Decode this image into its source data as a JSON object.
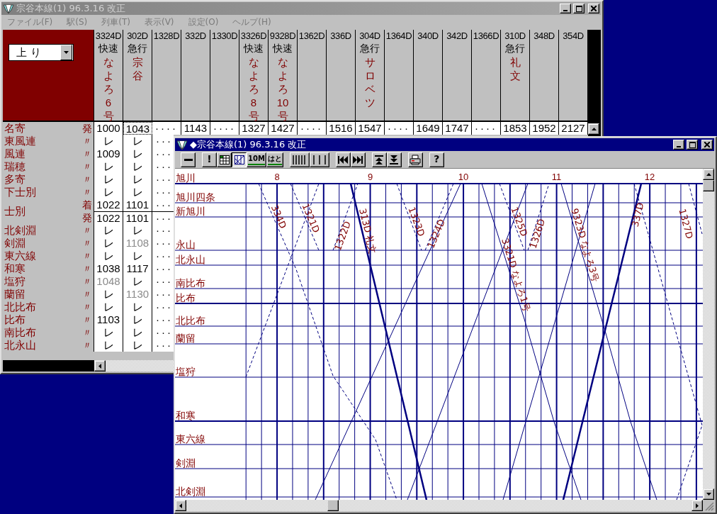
{
  "timetable_window": {
    "title": "宗谷本線(1) 96.3.16 改正",
    "active": false,
    "menu": [
      "ファイル(F)",
      "駅(S)",
      "列車(T)",
      "表示(V)",
      "設定(O)",
      "ヘルプ(H)"
    ],
    "direction": "上 り",
    "trains": [
      {
        "number": "3324D",
        "type": "快速",
        "name": "なよろ6号"
      },
      {
        "number": "302D",
        "type": "急行",
        "name": "宗谷"
      },
      {
        "number": "1328D"
      },
      {
        "number": "332D"
      },
      {
        "number": "1330D"
      },
      {
        "number": "3326D",
        "type": "快速",
        "name": "なよろ8号"
      },
      {
        "number": "9328D",
        "type": "快速",
        "name": "なよろ10号"
      },
      {
        "number": "1362D"
      },
      {
        "number": "336D"
      },
      {
        "number": "304D",
        "type": "急行",
        "name": "サロベツ"
      },
      {
        "number": "1364D"
      },
      {
        "number": "340D"
      },
      {
        "number": "342D"
      },
      {
        "number": "1366D"
      },
      {
        "number": "310D",
        "type": "急行",
        "name": "礼文"
      },
      {
        "number": "348D"
      },
      {
        "number": "354D"
      }
    ],
    "stations": [
      {
        "name": "名寄",
        "lines": [
          {
            "mark": "発",
            "cells": [
              {
                "v": "1000",
                "grey": false,
                "selected": false
              },
              {
                "v": "1043",
                "grey": false,
                "selected": true
              },
              {
                "v": "····",
                "grey": false,
                "selected": false
              },
              {
                "v": "1143",
                "grey": false,
                "selected": false
              },
              {
                "v": "····",
                "grey": false,
                "selected": false
              },
              {
                "v": "1327",
                "grey": false,
                "selected": false
              },
              {
                "v": "1427",
                "grey": false,
                "selected": false
              },
              {
                "v": "····",
                "grey": false,
                "selected": false
              },
              {
                "v": "1516",
                "grey": false,
                "selected": false
              },
              {
                "v": "1547",
                "grey": false,
                "selected": false
              },
              {
                "v": "····",
                "grey": false,
                "selected": false
              },
              {
                "v": "1649",
                "grey": false,
                "selected": false
              },
              {
                "v": "1747",
                "grey": false,
                "selected": false
              },
              {
                "v": "····",
                "grey": false,
                "selected": false
              },
              {
                "v": "1853",
                "grey": false,
                "selected": false
              },
              {
                "v": "1952",
                "grey": false,
                "selected": false
              },
              {
                "v": "2127",
                "grey": false,
                "selected": false
              }
            ]
          }
        ]
      },
      {
        "name": "東風連",
        "lines": [
          {
            "mark": "〃",
            "cells": [
              {
                "v": "レ",
                "grey": false,
                "selected": false
              },
              {
                "v": "レ",
                "grey": false,
                "selected": false
              },
              {
                "v": "···",
                "grey": false,
                "selected": false
              }
            ]
          }
        ]
      },
      {
        "name": "風連",
        "lines": [
          {
            "mark": "〃",
            "cells": [
              {
                "v": "1009",
                "grey": false,
                "selected": false
              },
              {
                "v": "レ",
                "grey": false,
                "selected": false
              },
              {
                "v": "···",
                "grey": false,
                "selected": false
              }
            ]
          }
        ]
      },
      {
        "name": "瑞穂",
        "lines": [
          {
            "mark": "〃",
            "cells": [
              {
                "v": "レ",
                "grey": false,
                "selected": false
              },
              {
                "v": "レ",
                "grey": false,
                "selected": false
              },
              {
                "v": "···",
                "grey": false,
                "selected": false
              }
            ]
          }
        ]
      },
      {
        "name": "多寄",
        "lines": [
          {
            "mark": "〃",
            "cells": [
              {
                "v": "レ",
                "grey": false,
                "selected": false
              },
              {
                "v": "レ",
                "grey": false,
                "selected": false
              },
              {
                "v": "···",
                "grey": false,
                "selected": false
              }
            ]
          }
        ]
      },
      {
        "name": "下士別",
        "lines": [
          {
            "mark": "〃",
            "cells": [
              {
                "v": "レ",
                "grey": false,
                "selected": false
              },
              {
                "v": "レ",
                "grey": false,
                "selected": false
              },
              {
                "v": "···",
                "grey": false,
                "selected": false
              }
            ]
          }
        ]
      },
      {
        "name": "士別",
        "lines": [
          {
            "mark": "着",
            "cells": [
              {
                "v": "1022",
                "grey": false,
                "selected": false
              },
              {
                "v": "1101",
                "grey": false,
                "selected": false
              },
              {
                "v": "···",
                "grey": false,
                "selected": false
              }
            ]
          },
          {
            "mark": "発",
            "cells": [
              {
                "v": "1022",
                "grey": false,
                "selected": false
              },
              {
                "v": "1101",
                "grey": false,
                "selected": false
              },
              {
                "v": "···",
                "grey": false,
                "selected": false
              }
            ]
          }
        ]
      },
      {
        "name": "北剣淵",
        "lines": [
          {
            "mark": "〃",
            "cells": [
              {
                "v": "レ",
                "grey": false,
                "selected": false
              },
              {
                "v": "レ",
                "grey": false,
                "selected": false
              },
              {
                "v": "···",
                "grey": false,
                "selected": false
              }
            ]
          }
        ]
      },
      {
        "name": "剣淵",
        "lines": [
          {
            "mark": "〃",
            "cells": [
              {
                "v": "レ",
                "grey": false,
                "selected": false
              },
              {
                "v": "1108",
                "grey": true,
                "selected": false
              },
              {
                "v": "···",
                "grey": false,
                "selected": false
              }
            ]
          }
        ]
      },
      {
        "name": "東六線",
        "lines": [
          {
            "mark": "〃",
            "cells": [
              {
                "v": "レ",
                "grey": false,
                "selected": false
              },
              {
                "v": "レ",
                "grey": false,
                "selected": false
              },
              {
                "v": "···",
                "grey": false,
                "selected": false
              }
            ]
          }
        ]
      },
      {
        "name": "和寒",
        "lines": [
          {
            "mark": "〃",
            "cells": [
              {
                "v": "1038",
                "grey": false,
                "selected": false
              },
              {
                "v": "1117",
                "grey": false,
                "selected": false
              },
              {
                "v": "···",
                "grey": false,
                "selected": false
              }
            ]
          }
        ]
      },
      {
        "name": "塩狩",
        "lines": [
          {
            "mark": "〃",
            "cells": [
              {
                "v": "1048",
                "grey": true,
                "selected": false
              },
              {
                "v": "レ",
                "grey": false,
                "selected": false
              },
              {
                "v": "···",
                "grey": false,
                "selected": false
              }
            ]
          }
        ]
      },
      {
        "name": "蘭留",
        "lines": [
          {
            "mark": "〃",
            "cells": [
              {
                "v": "レ",
                "grey": false,
                "selected": false
              },
              {
                "v": "1130",
                "grey": true,
                "selected": false
              },
              {
                "v": "···",
                "grey": false,
                "selected": false
              }
            ]
          }
        ]
      },
      {
        "name": "北比布",
        "lines": [
          {
            "mark": "〃",
            "cells": [
              {
                "v": "レ",
                "grey": false,
                "selected": false
              },
              {
                "v": "レ",
                "grey": false,
                "selected": false
              },
              {
                "v": "···",
                "grey": false,
                "selected": false
              }
            ]
          }
        ]
      },
      {
        "name": "比布",
        "lines": [
          {
            "mark": "〃",
            "cells": [
              {
                "v": "1103",
                "grey": false,
                "selected": false
              },
              {
                "v": "レ",
                "grey": false,
                "selected": false
              },
              {
                "v": "···",
                "grey": false,
                "selected": false
              }
            ]
          }
        ]
      },
      {
        "name": "南比布",
        "lines": [
          {
            "mark": "〃",
            "cells": [
              {
                "v": "レ",
                "grey": false,
                "selected": false
              },
              {
                "v": "レ",
                "grey": false,
                "selected": false
              },
              {
                "v": "···",
                "grey": false,
                "selected": false
              }
            ]
          }
        ]
      },
      {
        "name": "北永山",
        "lines": [
          {
            "mark": "〃",
            "cells": [
              {
                "v": "レ",
                "grey": false,
                "selected": false
              },
              {
                "v": "レ",
                "grey": false,
                "selected": false
              },
              {
                "v": "···",
                "grey": false,
                "selected": false
              }
            ]
          }
        ]
      }
    ]
  },
  "diagram_window": {
    "title": "◆宗谷本線(1) 96.3.16 改正",
    "active": true,
    "toolbar": [
      [
        {
          "kind": "bar",
          "pressed": false
        }
      ],
      [
        {
          "kind": "text",
          "label": "!",
          "pressed": false,
          "on": false
        },
        {
          "kind": "grid",
          "pressed": false
        },
        {
          "kind": "diagonal",
          "pressed": true
        },
        {
          "kind": "text",
          "label": "10M",
          "pressed": false,
          "on": true
        },
        {
          "kind": "text",
          "label": "はと",
          "pressed": false,
          "on": true
        }
      ],
      [
        {
          "kind": "lines-many",
          "pressed": false
        },
        {
          "kind": "lines-few",
          "pressed": false
        }
      ],
      [
        {
          "kind": "rewind",
          "pressed": false
        },
        {
          "kind": "forward",
          "pressed": false
        }
      ],
      [
        {
          "kind": "top",
          "pressed": false
        },
        {
          "kind": "bottom",
          "pressed": false
        }
      ],
      [
        {
          "kind": "printer",
          "pressed": false
        }
      ],
      [
        {
          "kind": "text",
          "label": "?",
          "pressed": false,
          "on": false
        }
      ]
    ],
    "hours": [
      "8",
      "9",
      "10",
      "11",
      "12"
    ],
    "stations": [
      {
        "name": "旭川",
        "major": true
      },
      {
        "name": "旭川四条",
        "major": false
      },
      {
        "name": "新旭川",
        "major": false
      },
      {
        "name": "永山",
        "major": false
      },
      {
        "name": "北永山",
        "major": false
      },
      {
        "name": "南比布",
        "major": false
      },
      {
        "name": "比布",
        "major": true
      },
      {
        "name": "北比布",
        "major": false
      },
      {
        "name": "蘭留",
        "major": false
      },
      {
        "name": "塩狩",
        "major": false
      },
      {
        "name": "和寒",
        "major": true
      },
      {
        "name": "東六線",
        "major": false
      },
      {
        "name": "剣淵",
        "major": false
      },
      {
        "name": "北剣淵",
        "major": false
      }
    ],
    "trains": [
      {
        "label": "334D",
        "kind": "dashed"
      },
      {
        "label": "1321D",
        "kind": "dashed"
      },
      {
        "label": "1322D",
        "kind": "dashed"
      },
      {
        "label": "313D 礼文",
        "kind": "bold"
      },
      {
        "label": "1323D",
        "kind": "dashed"
      },
      {
        "label": "1324D",
        "kind": "dashed"
      },
      {
        "label": "3321D なよろ1号",
        "kind": "thin"
      },
      {
        "label": "1325D",
        "kind": "dashed"
      },
      {
        "label": "1326D",
        "kind": "dashed"
      },
      {
        "label": "9323D なよろ3号",
        "kind": "thin"
      },
      {
        "label": "337D",
        "kind": "bold"
      },
      {
        "label": "1327D",
        "kind": "dashed"
      },
      {
        "kind": "dashed"
      },
      {
        "kind": "thin"
      },
      {
        "kind": "thin"
      },
      {
        "kind": "thin"
      },
      {
        "kind": "dashed"
      },
      {
        "kind": "dashed"
      }
    ]
  }
}
